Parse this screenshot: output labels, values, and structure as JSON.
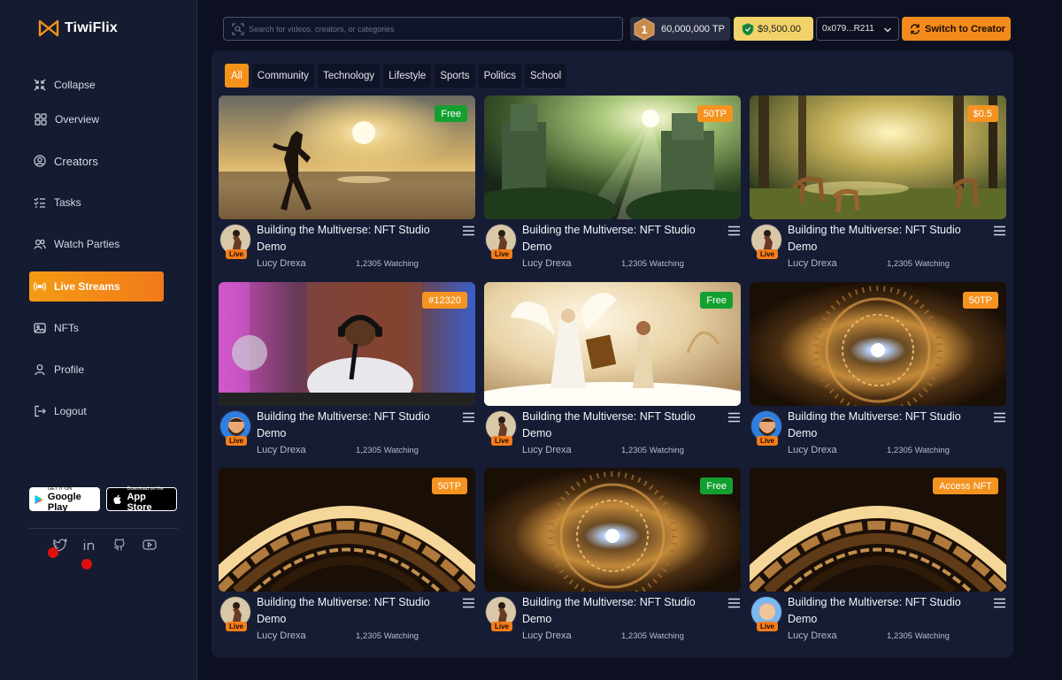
{
  "app": {
    "name": "TiwiFlix"
  },
  "sidebar": {
    "collapse_label": "Collapse",
    "items": [
      {
        "label": "Overview",
        "icon": "grid-icon"
      },
      {
        "label": "Creators",
        "icon": "user-circle-icon"
      },
      {
        "label": "Tasks",
        "icon": "checklist-icon"
      },
      {
        "label": "Watch Parties",
        "icon": "users-icon"
      },
      {
        "label": "Live Streams",
        "icon": "broadcast-icon",
        "active": true
      },
      {
        "label": "NFTs",
        "icon": "image-icon"
      },
      {
        "label": "Profile",
        "icon": "user-icon"
      },
      {
        "label": "Logout",
        "icon": "logout-icon"
      }
    ],
    "google_play": {
      "top": "GET IT ON",
      "name": "Google Play"
    },
    "app_store": {
      "top": "Download on the",
      "name": "App Store"
    },
    "social": [
      "twitter-icon",
      "linkedin-icon",
      "github-icon",
      "youtube-icon"
    ]
  },
  "header": {
    "search_placeholder": "Search for videos, creators, or categories",
    "tp_rank": "1",
    "tp_balance": "60,000,000 TP",
    "cash_balance": "$9,500.00",
    "wallet": "0x079...R211",
    "switch_label": "Switch to Creator"
  },
  "filters": [
    "All",
    "Community",
    "Technology",
    "Lifestyle",
    "Sports",
    "Politics",
    "School"
  ],
  "colors": {
    "accent": "#f5921a",
    "free_badge": "#14a030",
    "background": "#0c1020",
    "panel": "#161c33"
  },
  "cards": [
    {
      "badge": "Free",
      "badge_color": "green",
      "title": "Building the Multiverse: NFT Studio Demo",
      "author": "Lucy Drexa",
      "watching": "1,2305 Watching",
      "live": "Live",
      "scene": "beach-runner",
      "avatar": "runner"
    },
    {
      "badge": "50TP",
      "badge_color": "orange",
      "title": "Building the Multiverse: NFT Studio Demo",
      "author": "Lucy Drexa",
      "watching": "1,2305 Watching",
      "live": "Live",
      "scene": "jungle-ruins",
      "avatar": "runner"
    },
    {
      "badge": "$0.5",
      "badge_color": "orange",
      "title": "Building the Multiverse: NFT Studio Demo",
      "author": "Lucy Drexa",
      "watching": "1,2305 Watching",
      "live": "Live",
      "scene": "deer-forest",
      "avatar": "runner"
    },
    {
      "badge": "#12320",
      "badge_color": "orange",
      "title": "Building the Multiverse: NFT Studio Demo",
      "author": "Lucy Drexa",
      "watching": "1,2305 Watching",
      "live": "Live",
      "scene": "podcast-studio",
      "avatar": "bearded"
    },
    {
      "badge": "Free",
      "badge_color": "green",
      "title": "Building the Multiverse: NFT Studio Demo",
      "author": "Lucy Drexa",
      "watching": "1,2305 Watching",
      "live": "Live",
      "scene": "angel-clouds",
      "avatar": "runner"
    },
    {
      "badge": "50TP",
      "badge_color": "orange",
      "title": "Building the Multiverse: NFT Studio Demo",
      "author": "Lucy Drexa",
      "watching": "1,2305 Watching",
      "live": "Live",
      "scene": "golden-portal",
      "avatar": "bearded"
    },
    {
      "badge": "50TP",
      "badge_color": "orange",
      "title": "Building the Multiverse: NFT Studio Demo",
      "author": "Lucy Drexa",
      "watching": "1,2305 Watching",
      "live": "Live",
      "scene": "arched-tunnel",
      "avatar": "runner"
    },
    {
      "badge": "Free",
      "badge_color": "green",
      "title": "Building the Multiverse: NFT Studio Demo",
      "author": "Lucy Drexa",
      "watching": "1,2305 Watching",
      "live": "Live",
      "scene": "golden-portal",
      "avatar": "runner"
    },
    {
      "badge": "Access NFT",
      "badge_color": "orange",
      "title": "Building the Multiverse: NFT Studio Demo",
      "author": "Lucy Drexa",
      "watching": "1,2305 Watching",
      "live": "Live",
      "scene": "arched-tunnel",
      "avatar": "cartoon"
    }
  ]
}
